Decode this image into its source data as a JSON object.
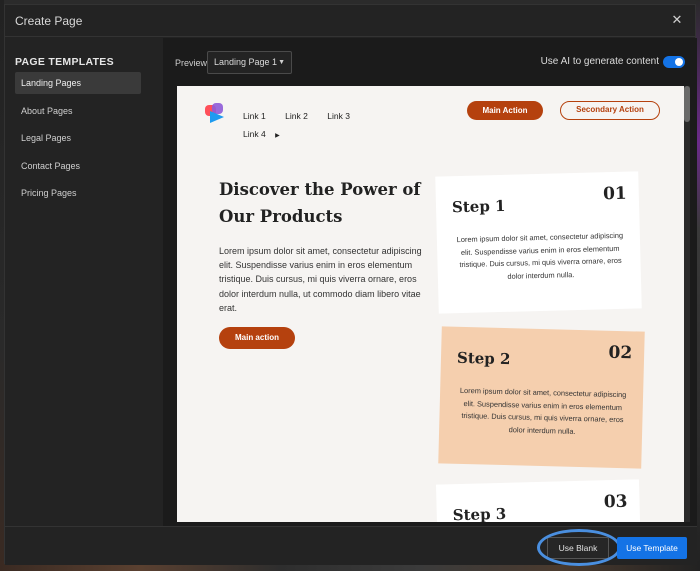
{
  "modal": {
    "title": "Create Page",
    "close_glyph": "✕"
  },
  "sidebar": {
    "heading": "PAGE TEMPLATES",
    "items": [
      {
        "label": "Landing Pages",
        "active": true
      },
      {
        "label": "About Pages",
        "active": false
      },
      {
        "label": "Legal Pages",
        "active": false
      },
      {
        "label": "Contact Pages",
        "active": false
      },
      {
        "label": "Pricing Pages",
        "active": false
      }
    ]
  },
  "toolbar": {
    "preview_label": "Preview",
    "preview_selected": "Landing Page 1",
    "ai_label": "Use AI to generate content",
    "ai_enabled": true
  },
  "preview": {
    "nav_links": [
      "Link 1",
      "Link 2",
      "Link 3",
      "Link 4"
    ],
    "main_action": "Main Action",
    "secondary_action": "Secondary Action",
    "hero_title": "Discover the Power of Our Products",
    "hero_body": "Lorem ipsum dolor sit amet, consectetur adipiscing elit. Suspendisse varius enim in eros elementum tristique. Duis cursus, mi quis viverra ornare, eros dolor interdum nulla, ut commodo diam libero vitae erat.",
    "hero_button": "Main action",
    "steps": [
      {
        "title": "Step 1",
        "number": "01",
        "body": "Lorem ipsum dolor sit amet, consectetur adipiscing elit. Suspendisse varius enim in eros elementum tristique. Duis cursus, mi quis viverra ornare, eros dolor interdum nulla."
      },
      {
        "title": "Step 2",
        "number": "02",
        "body": "Lorem ipsum dolor sit amet, consectetur adipiscing elit. Suspendisse varius enim in eros elementum tristique. Duis cursus, mi quis viverra ornare, eros dolor interdum nulla."
      },
      {
        "title": "Step 3",
        "number": "03",
        "body": ""
      }
    ],
    "accent_color": "#b5410e",
    "highlight_card_color": "#f5cfae"
  },
  "footer": {
    "use_blank": "Use Blank",
    "use_template": "Use Template",
    "primary_color": "#1473e6"
  }
}
